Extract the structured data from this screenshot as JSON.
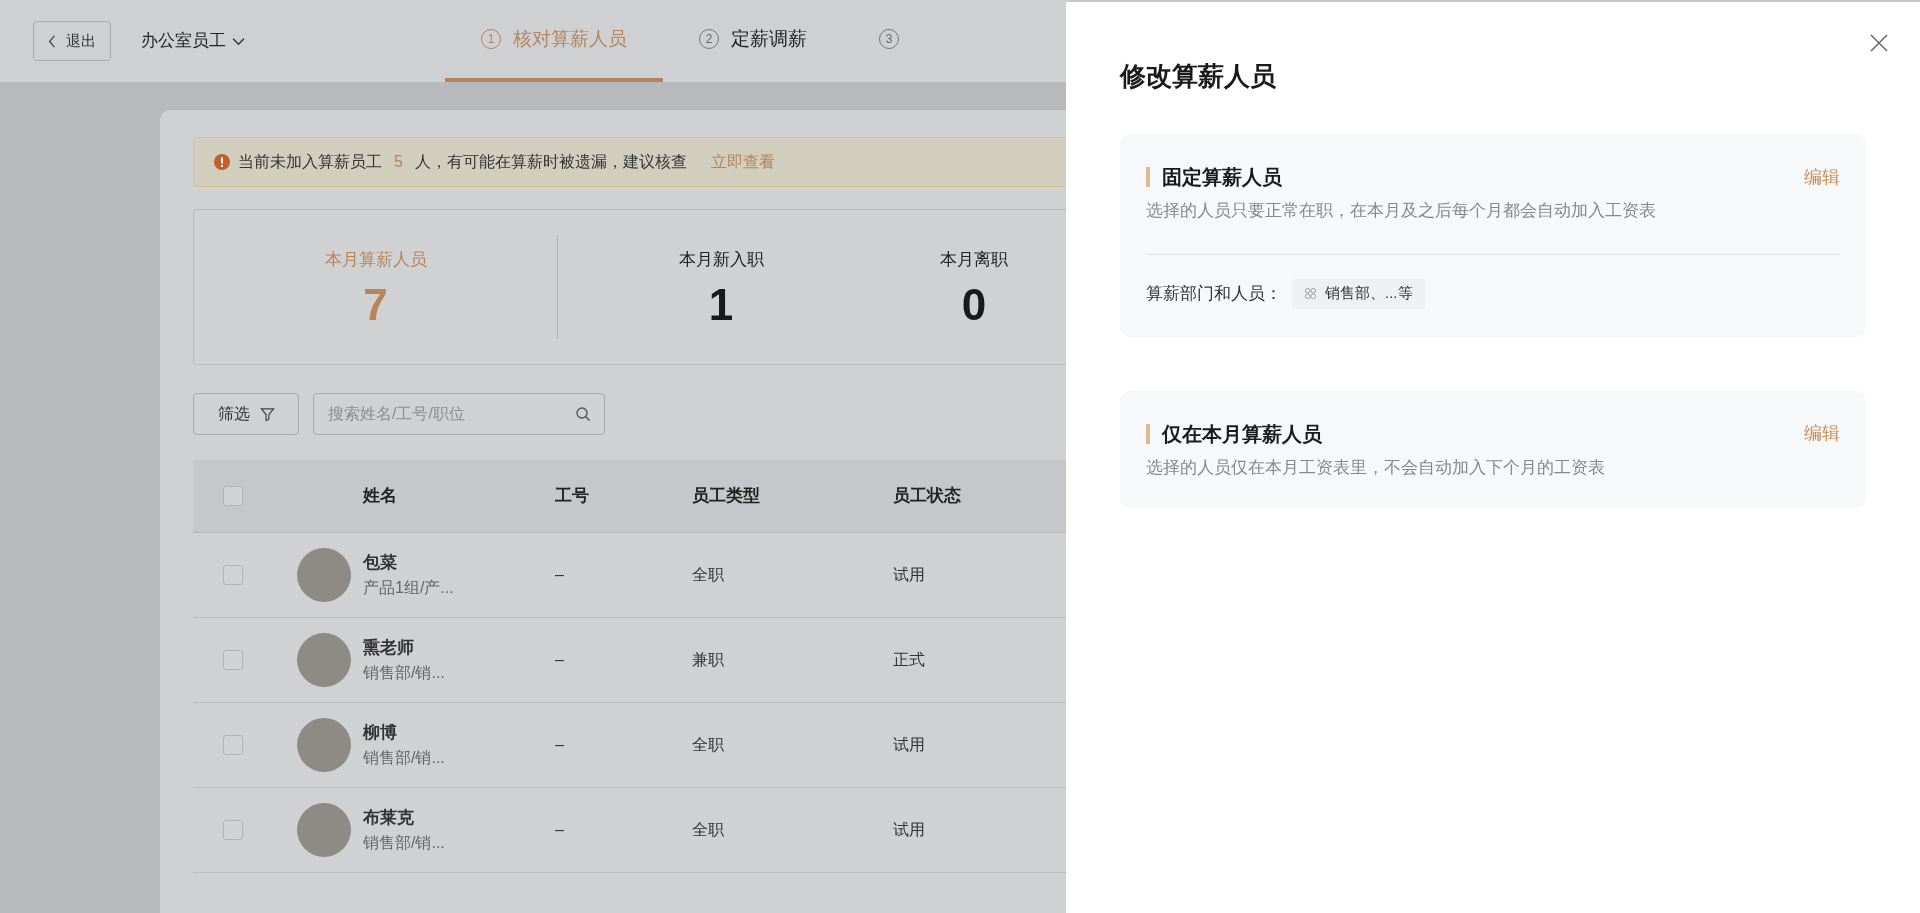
{
  "header": {
    "back_button": "退出",
    "group_selector": "办公室员工",
    "steps": [
      {
        "number": "1",
        "label": "核对算薪人员",
        "selected": true
      },
      {
        "number": "2",
        "label": "定薪调薪",
        "selected": false
      },
      {
        "number": "3",
        "selected": false
      }
    ]
  },
  "alert": {
    "text_before": "当前未加入算薪员工",
    "count": "5",
    "text_after": "人，有可能在算薪时被遗漏，建议核查",
    "link": "立即查看"
  },
  "stats": [
    {
      "label": "本月算薪人员",
      "value": "7",
      "selected": true
    },
    {
      "label": "本月新入职",
      "value": "1",
      "selected": false
    },
    {
      "label": "本月离职",
      "value": "0",
      "selected": false
    }
  ],
  "filter_button": "筛选",
  "search": {
    "placeholder": "搜索姓名/工号/职位"
  },
  "table": {
    "header_checkbox": {
      "checked": false
    },
    "columns": [
      "姓名",
      "工号",
      "员工类型",
      "员工状态"
    ],
    "rows": [
      {
        "checked": false,
        "name": "包菜",
        "dept": "产品1组/产...",
        "id": "–",
        "type": "全职",
        "status": "试用"
      },
      {
        "checked": false,
        "name": "熏老师",
        "dept": "销售部/销...",
        "id": "–",
        "type": "兼职",
        "status": "正式"
      },
      {
        "checked": false,
        "name": "柳博",
        "dept": "销售部/销...",
        "id": "–",
        "type": "全职",
        "status": "试用"
      },
      {
        "checked": false,
        "name": "布莱克",
        "dept": "销售部/销...",
        "id": "–",
        "type": "全职",
        "status": "试用"
      }
    ]
  },
  "drawer": {
    "title": "修改算薪人员",
    "sections": [
      {
        "title": "固定算薪人员",
        "description": "选择的人员只要正常在职，在本月及之后每个月都会自动加入工资表",
        "edit": "编辑",
        "field_label": "算薪部门和人员：",
        "field_value": "销售部、...等"
      },
      {
        "title": "仅在本月算薪人员",
        "description": "选择的人员仅在本月工资表里，不会自动加入下个月的工资表",
        "edit": "编辑"
      }
    ]
  }
}
